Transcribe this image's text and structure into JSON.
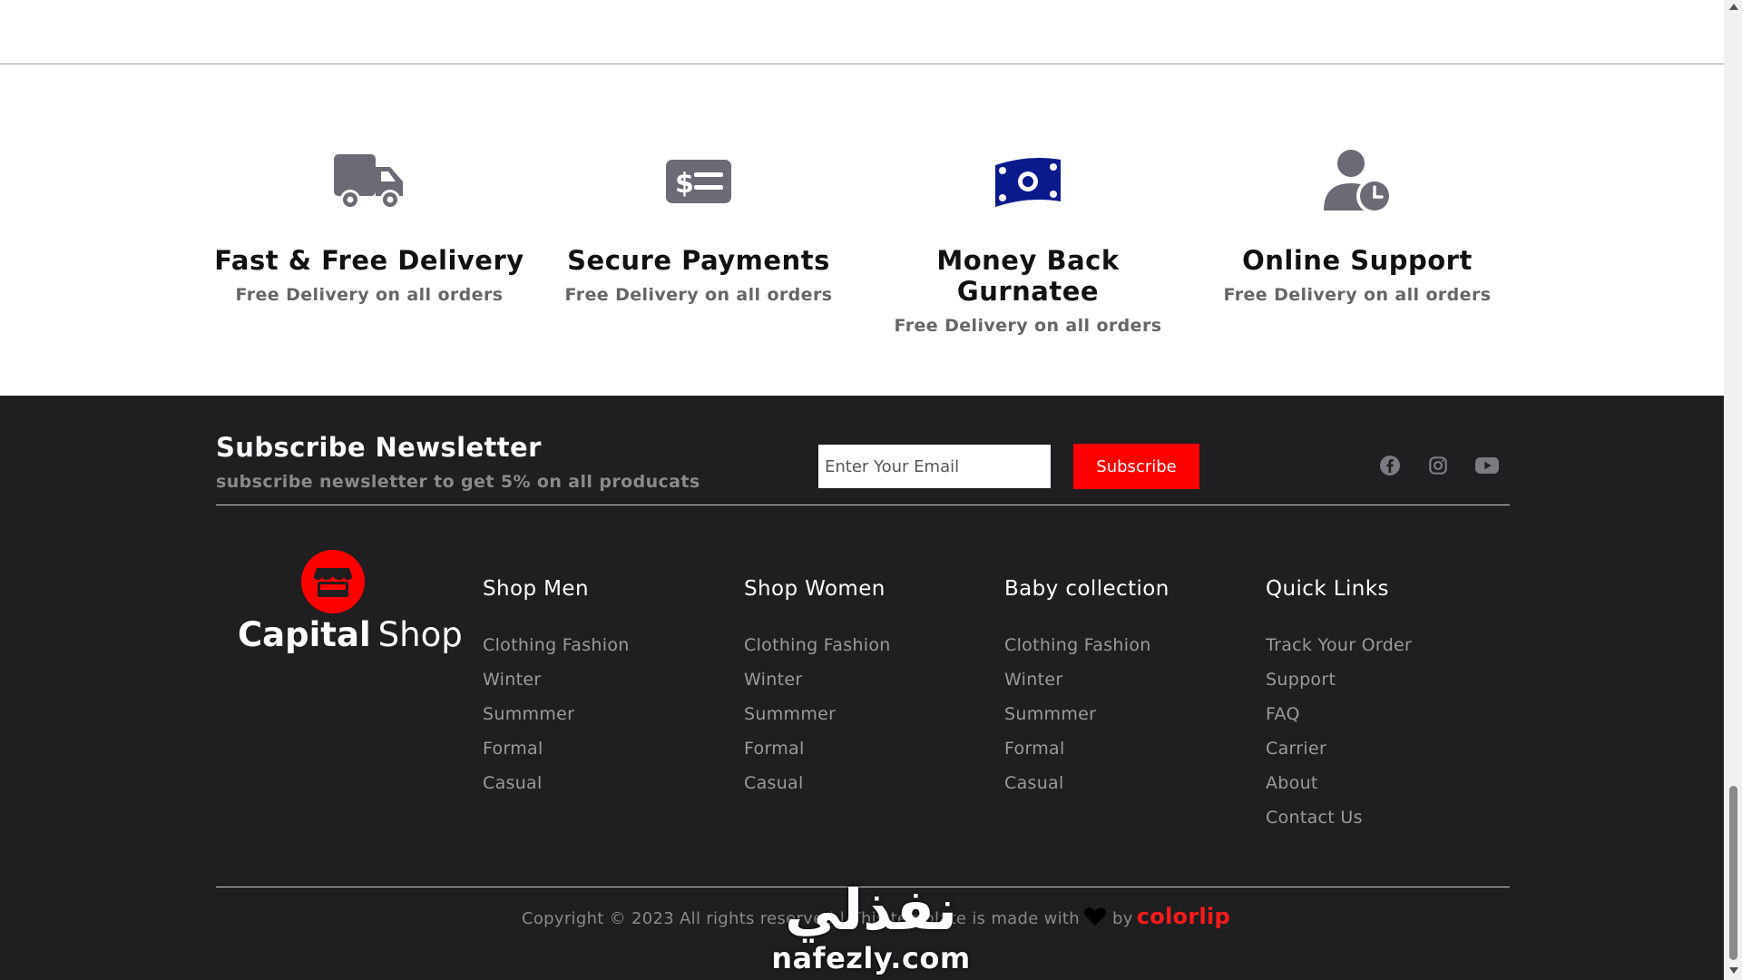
{
  "features": [
    {
      "icon": "truck-icon",
      "title": "Fast & Free Delivery",
      "subtitle": "Free Delivery on all orders"
    },
    {
      "icon": "payment-card-icon",
      "title": "Secure Payments",
      "subtitle": "Free Delivery on all orders"
    },
    {
      "icon": "money-icon",
      "title": "Money Back Gurnatee",
      "subtitle": "Free Delivery on all orders"
    },
    {
      "icon": "user-clock-icon",
      "title": "Online Support",
      "subtitle": "Free Delivery on all orders"
    }
  ],
  "newsletter": {
    "title": "Subscribe Newsletter",
    "subtitle": "subscribe newsletter to get 5% on all producats",
    "email_placeholder": "Enter Your Email",
    "button_label": "Subscribe"
  },
  "social": [
    "facebook-icon",
    "instagram-icon",
    "youtube-icon"
  ],
  "logo": {
    "bold": "Capital",
    "light": "Shop"
  },
  "columns": [
    {
      "title": "Shop Men",
      "links": [
        "Clothing Fashion",
        "Winter",
        "Summmer",
        "Formal",
        "Casual"
      ]
    },
    {
      "title": "Shop Women",
      "links": [
        "Clothing Fashion",
        "Winter",
        "Summmer",
        "Formal",
        "Casual"
      ]
    },
    {
      "title": "Baby collection",
      "links": [
        "Clothing Fashion",
        "Winter",
        "Summmer",
        "Formal",
        "Casual"
      ]
    },
    {
      "title": "Quick Links",
      "links": [
        "Track Your Order",
        "Support",
        "FAQ",
        "Carrier",
        "About",
        "Contact Us"
      ]
    }
  ],
  "copyright": {
    "text": "Copyright © 2023 All rights reserved | This template is made with",
    "by": "by",
    "brand": "colorlip"
  },
  "watermark": {
    "arabic": "نفذلي",
    "latin": "nafezly.com"
  },
  "colors": {
    "accent": "#ff0000",
    "footer_bg": "#1f1e20",
    "icon_gray": "#6b6a75",
    "icon_navy": "#0a1a8c"
  }
}
